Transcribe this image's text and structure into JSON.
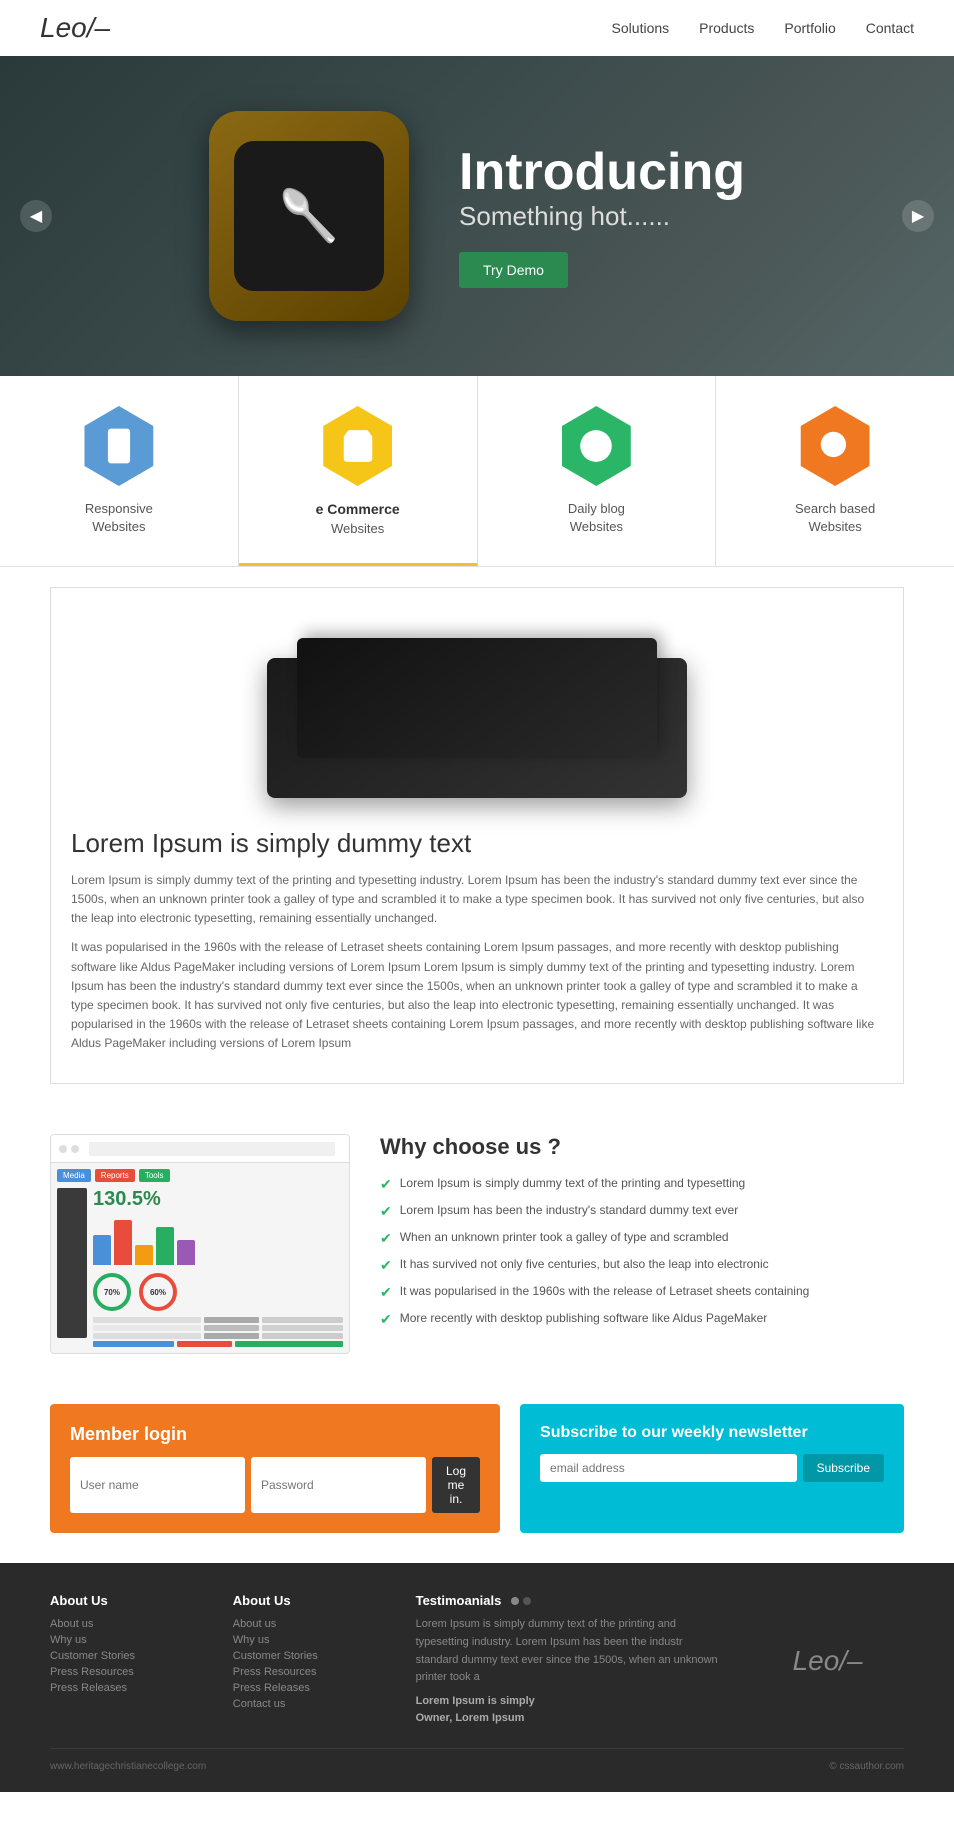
{
  "header": {
    "logo": "Leo/–",
    "nav": {
      "solutions": "Solutions",
      "products": "Products",
      "portfolio": "Portfolio",
      "contact": "Contact"
    }
  },
  "hero": {
    "heading": "Introducing",
    "subheading": "Something hot......",
    "cta": "Try Demo"
  },
  "features": [
    {
      "id": "responsive",
      "icon": "phone",
      "color": "hex-blue",
      "label": "Responsive",
      "label2": "Websites"
    },
    {
      "id": "ecommerce",
      "icon": "cart",
      "color": "hex-yellow",
      "label": "e Commerce",
      "label2": "Websites",
      "active": true
    },
    {
      "id": "blog",
      "icon": "globe",
      "color": "hex-green",
      "label": "Daily blog",
      "label2": "Websites"
    },
    {
      "id": "search",
      "icon": "search",
      "color": "hex-orange",
      "label": "Search based",
      "label2": "Websites"
    }
  ],
  "product": {
    "heading": "Lorem Ipsum is simply dummy text",
    "para1": "Lorem Ipsum is simply dummy text of the printing and typesetting industry. Lorem Ipsum has been the industry's standard dummy text ever since the 1500s, when an unknown printer took a galley of type and scrambled it to make a type specimen book. It has survived not only five centuries, but also the leap into electronic typesetting, remaining essentially unchanged.",
    "para2": "It was popularised in the 1960s with the release of Letraset sheets containing Lorem Ipsum passages, and more recently with desktop publishing software like Aldus PageMaker including versions of Lorem Ipsum Lorem Ipsum is simply dummy text of the printing and typesetting industry. Lorem Ipsum has been the industry's standard dummy text ever since the 1500s, when an unknown printer took a galley of type and scrambled it to make a type specimen book. It has survived not only five centuries, but also the leap into electronic typesetting, remaining essentially unchanged. It was popularised in the 1960s with the release of Letraset sheets containing Lorem Ipsum passages, and more recently with desktop publishing software like Aldus PageMaker including versions of Lorem Ipsum"
  },
  "why": {
    "title": "Why choose us ?",
    "items": [
      "Lorem Ipsum is simply dummy text of the printing and typesetting",
      "Lorem Ipsum has been the industry's standard dummy text ever",
      "When an unknown printer took a galley of type and scrambled",
      "It has survived not only five centuries, but also the leap into electronic",
      "It was popularised in the 1960s with the release of Letraset sheets containing",
      "More recently with desktop publishing software like Aldus PageMaker"
    ],
    "dashboard": {
      "stat": "130.5%",
      "circle1": "70%",
      "circle2": "60%"
    }
  },
  "login": {
    "title": "Member login",
    "username_placeholder": "User name",
    "password_placeholder": "Password",
    "btn": "Log me in."
  },
  "newsletter": {
    "title": "Subscribe to our weekly newsletter",
    "email_placeholder": "email address",
    "btn": "Subscribe"
  },
  "footer": {
    "col1": {
      "title": "About Us",
      "links": [
        "About us",
        "Why us",
        "Customer Stories",
        "Press Resources",
        "Press Releases"
      ]
    },
    "col2": {
      "title": "About Us",
      "links": [
        "About us",
        "Why us",
        "Customer Stories",
        "Press Resources",
        "Press Releases",
        "Contact us"
      ]
    },
    "testimonial": {
      "title": "Testimoanials",
      "text": "Lorem Ipsum is simply dummy text of the printing and typesetting industry. Lorem Ipsum has been the industr standard dummy text ever since the 1500s, when an unknown printer took a",
      "author_bold": "Lorem Ipsum is simply",
      "author": "Owner, Lorem Ipsum"
    },
    "logo": "Leo/–",
    "left_credit": "www.heritagechristianecollege.com",
    "right_credit": "© cssauthor.com"
  }
}
